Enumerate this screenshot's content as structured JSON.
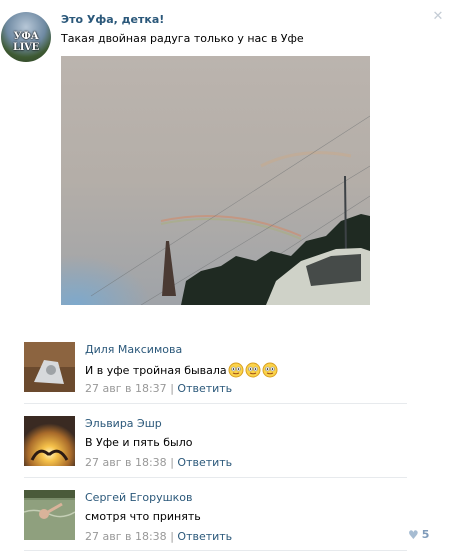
{
  "post": {
    "group_name": "Это Уфа, детка!",
    "avatar_text": "УФА LIVE",
    "text": "Такая двойная радуга только у нас в Уфе",
    "close_icon": "close-icon"
  },
  "comments": [
    {
      "author": "Диля Максимова",
      "text": "И в уфе тройная бывала",
      "smileys": 3,
      "date": "27 авг в 18:37",
      "separator": "|",
      "reply": "Ответить"
    },
    {
      "author": "Эльвира Эшр",
      "text": "В Уфе и пять было",
      "date": "27 авг в 18:38",
      "separator": "|",
      "reply": "Ответить"
    },
    {
      "author": "Сергей Егорушков",
      "text": "смотря что принять",
      "date": "27 авг в 18:38",
      "separator": "|",
      "reply": "Ответить",
      "likes": "5"
    }
  ],
  "colors": {
    "link": "#2b587a",
    "meta": "#999999",
    "like": "#7f9bba"
  }
}
